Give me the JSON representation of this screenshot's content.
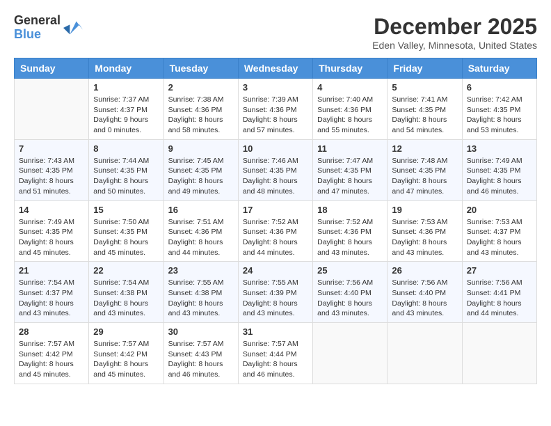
{
  "header": {
    "logo_general": "General",
    "logo_blue": "Blue",
    "month_title": "December 2025",
    "location": "Eden Valley, Minnesota, United States"
  },
  "weekdays": [
    "Sunday",
    "Monday",
    "Tuesday",
    "Wednesday",
    "Thursday",
    "Friday",
    "Saturday"
  ],
  "weeks": [
    [
      {
        "day": "",
        "sunrise": "",
        "sunset": "",
        "daylight": ""
      },
      {
        "day": "1",
        "sunrise": "Sunrise: 7:37 AM",
        "sunset": "Sunset: 4:37 PM",
        "daylight": "Daylight: 9 hours and 0 minutes."
      },
      {
        "day": "2",
        "sunrise": "Sunrise: 7:38 AM",
        "sunset": "Sunset: 4:36 PM",
        "daylight": "Daylight: 8 hours and 58 minutes."
      },
      {
        "day": "3",
        "sunrise": "Sunrise: 7:39 AM",
        "sunset": "Sunset: 4:36 PM",
        "daylight": "Daylight: 8 hours and 57 minutes."
      },
      {
        "day": "4",
        "sunrise": "Sunrise: 7:40 AM",
        "sunset": "Sunset: 4:36 PM",
        "daylight": "Daylight: 8 hours and 55 minutes."
      },
      {
        "day": "5",
        "sunrise": "Sunrise: 7:41 AM",
        "sunset": "Sunset: 4:35 PM",
        "daylight": "Daylight: 8 hours and 54 minutes."
      },
      {
        "day": "6",
        "sunrise": "Sunrise: 7:42 AM",
        "sunset": "Sunset: 4:35 PM",
        "daylight": "Daylight: 8 hours and 53 minutes."
      }
    ],
    [
      {
        "day": "7",
        "sunrise": "Sunrise: 7:43 AM",
        "sunset": "Sunset: 4:35 PM",
        "daylight": "Daylight: 8 hours and 51 minutes."
      },
      {
        "day": "8",
        "sunrise": "Sunrise: 7:44 AM",
        "sunset": "Sunset: 4:35 PM",
        "daylight": "Daylight: 8 hours and 50 minutes."
      },
      {
        "day": "9",
        "sunrise": "Sunrise: 7:45 AM",
        "sunset": "Sunset: 4:35 PM",
        "daylight": "Daylight: 8 hours and 49 minutes."
      },
      {
        "day": "10",
        "sunrise": "Sunrise: 7:46 AM",
        "sunset": "Sunset: 4:35 PM",
        "daylight": "Daylight: 8 hours and 48 minutes."
      },
      {
        "day": "11",
        "sunrise": "Sunrise: 7:47 AM",
        "sunset": "Sunset: 4:35 PM",
        "daylight": "Daylight: 8 hours and 47 minutes."
      },
      {
        "day": "12",
        "sunrise": "Sunrise: 7:48 AM",
        "sunset": "Sunset: 4:35 PM",
        "daylight": "Daylight: 8 hours and 47 minutes."
      },
      {
        "day": "13",
        "sunrise": "Sunrise: 7:49 AM",
        "sunset": "Sunset: 4:35 PM",
        "daylight": "Daylight: 8 hours and 46 minutes."
      }
    ],
    [
      {
        "day": "14",
        "sunrise": "Sunrise: 7:49 AM",
        "sunset": "Sunset: 4:35 PM",
        "daylight": "Daylight: 8 hours and 45 minutes."
      },
      {
        "day": "15",
        "sunrise": "Sunrise: 7:50 AM",
        "sunset": "Sunset: 4:35 PM",
        "daylight": "Daylight: 8 hours and 45 minutes."
      },
      {
        "day": "16",
        "sunrise": "Sunrise: 7:51 AM",
        "sunset": "Sunset: 4:36 PM",
        "daylight": "Daylight: 8 hours and 44 minutes."
      },
      {
        "day": "17",
        "sunrise": "Sunrise: 7:52 AM",
        "sunset": "Sunset: 4:36 PM",
        "daylight": "Daylight: 8 hours and 44 minutes."
      },
      {
        "day": "18",
        "sunrise": "Sunrise: 7:52 AM",
        "sunset": "Sunset: 4:36 PM",
        "daylight": "Daylight: 8 hours and 43 minutes."
      },
      {
        "day": "19",
        "sunrise": "Sunrise: 7:53 AM",
        "sunset": "Sunset: 4:36 PM",
        "daylight": "Daylight: 8 hours and 43 minutes."
      },
      {
        "day": "20",
        "sunrise": "Sunrise: 7:53 AM",
        "sunset": "Sunset: 4:37 PM",
        "daylight": "Daylight: 8 hours and 43 minutes."
      }
    ],
    [
      {
        "day": "21",
        "sunrise": "Sunrise: 7:54 AM",
        "sunset": "Sunset: 4:37 PM",
        "daylight": "Daylight: 8 hours and 43 minutes."
      },
      {
        "day": "22",
        "sunrise": "Sunrise: 7:54 AM",
        "sunset": "Sunset: 4:38 PM",
        "daylight": "Daylight: 8 hours and 43 minutes."
      },
      {
        "day": "23",
        "sunrise": "Sunrise: 7:55 AM",
        "sunset": "Sunset: 4:38 PM",
        "daylight": "Daylight: 8 hours and 43 minutes."
      },
      {
        "day": "24",
        "sunrise": "Sunrise: 7:55 AM",
        "sunset": "Sunset: 4:39 PM",
        "daylight": "Daylight: 8 hours and 43 minutes."
      },
      {
        "day": "25",
        "sunrise": "Sunrise: 7:56 AM",
        "sunset": "Sunset: 4:40 PM",
        "daylight": "Daylight: 8 hours and 43 minutes."
      },
      {
        "day": "26",
        "sunrise": "Sunrise: 7:56 AM",
        "sunset": "Sunset: 4:40 PM",
        "daylight": "Daylight: 8 hours and 43 minutes."
      },
      {
        "day": "27",
        "sunrise": "Sunrise: 7:56 AM",
        "sunset": "Sunset: 4:41 PM",
        "daylight": "Daylight: 8 hours and 44 minutes."
      }
    ],
    [
      {
        "day": "28",
        "sunrise": "Sunrise: 7:57 AM",
        "sunset": "Sunset: 4:42 PM",
        "daylight": "Daylight: 8 hours and 45 minutes."
      },
      {
        "day": "29",
        "sunrise": "Sunrise: 7:57 AM",
        "sunset": "Sunset: 4:42 PM",
        "daylight": "Daylight: 8 hours and 45 minutes."
      },
      {
        "day": "30",
        "sunrise": "Sunrise: 7:57 AM",
        "sunset": "Sunset: 4:43 PM",
        "daylight": "Daylight: 8 hours and 46 minutes."
      },
      {
        "day": "31",
        "sunrise": "Sunrise: 7:57 AM",
        "sunset": "Sunset: 4:44 PM",
        "daylight": "Daylight: 8 hours and 46 minutes."
      },
      {
        "day": "",
        "sunrise": "",
        "sunset": "",
        "daylight": ""
      },
      {
        "day": "",
        "sunrise": "",
        "sunset": "",
        "daylight": ""
      },
      {
        "day": "",
        "sunrise": "",
        "sunset": "",
        "daylight": ""
      }
    ]
  ]
}
